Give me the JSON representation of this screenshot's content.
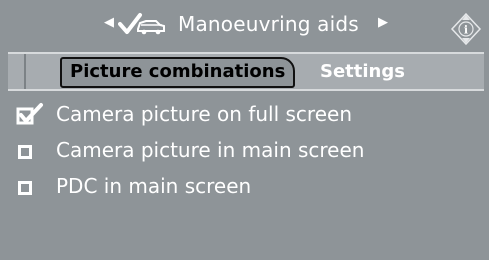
{
  "header": {
    "title": "Manoeuvring aids",
    "left_arrow_icon": "triangle-left-icon",
    "right_arrow_icon": "triangle-right-icon",
    "check_icon": "check-car-icon",
    "info_icon": "info-diamond-icon"
  },
  "tabs": [
    {
      "label": "Picture combinations",
      "active": true
    },
    {
      "label": "Settings",
      "active": false
    }
  ],
  "options": [
    {
      "label": "Camera picture on full screen",
      "checked": true
    },
    {
      "label": "Camera picture in main screen",
      "checked": false
    },
    {
      "label": "PDC in main screen",
      "checked": false
    }
  ],
  "colors": {
    "background": "#8e9498",
    "tabbar": "#a7acb0",
    "text": "#ffffff",
    "active_tab_text": "#000000"
  }
}
